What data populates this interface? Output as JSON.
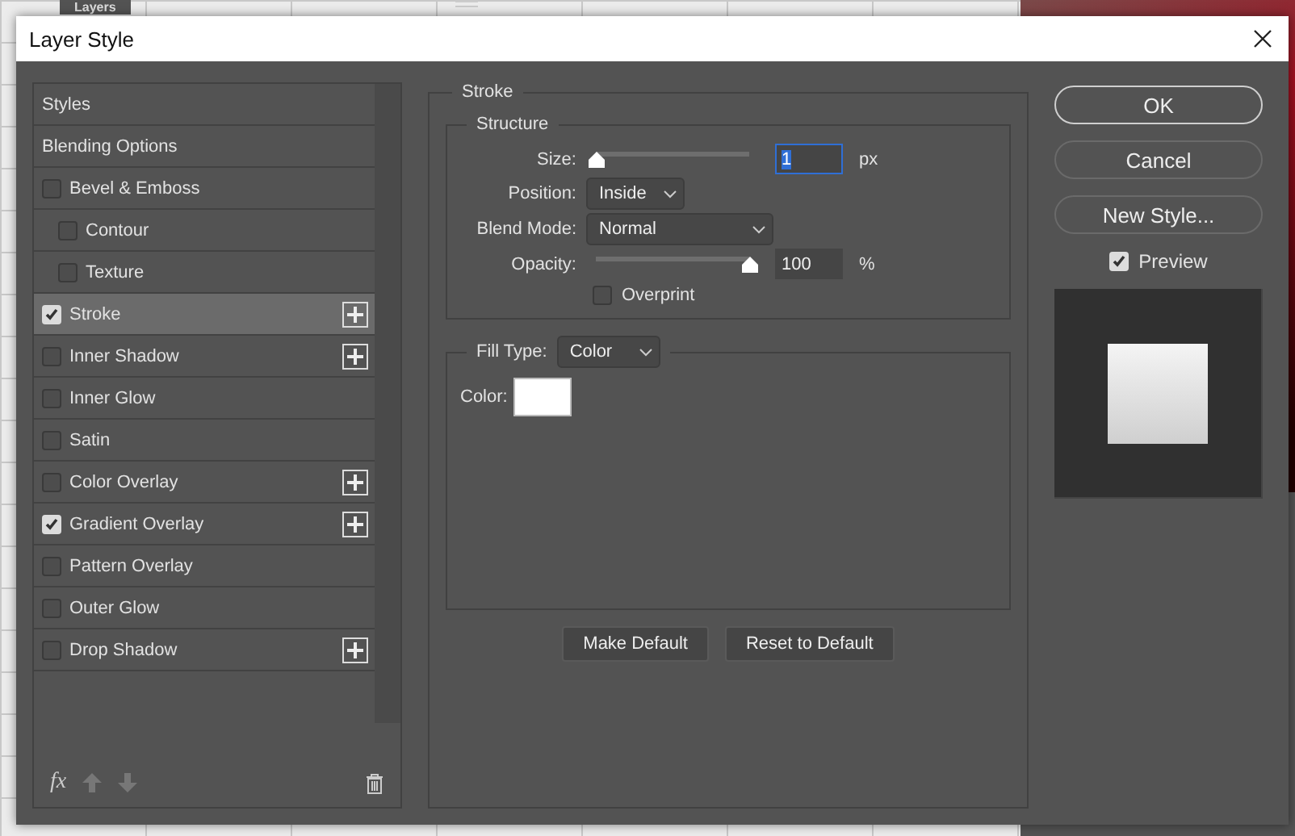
{
  "background": {
    "panel_tab": "Layers"
  },
  "window": {
    "title": "Layer Style"
  },
  "styles_list": {
    "items": [
      {
        "label": "Styles",
        "kind": "header",
        "selected": false
      },
      {
        "label": "Blending Options",
        "kind": "header",
        "selected": false
      },
      {
        "label": "Bevel & Emboss",
        "kind": "effect",
        "checked": false,
        "selected": false,
        "add_button": false,
        "children": [
          {
            "label": "Contour",
            "kind": "effect",
            "checked": false,
            "selected": false,
            "add_button": false
          },
          {
            "label": "Texture",
            "kind": "effect",
            "checked": false,
            "selected": false,
            "add_button": false
          }
        ]
      },
      {
        "label": "Stroke",
        "kind": "effect",
        "checked": true,
        "selected": true,
        "add_button": true
      },
      {
        "label": "Inner Shadow",
        "kind": "effect",
        "checked": false,
        "selected": false,
        "add_button": true
      },
      {
        "label": "Inner Glow",
        "kind": "effect",
        "checked": false,
        "selected": false,
        "add_button": false
      },
      {
        "label": "Satin",
        "kind": "effect",
        "checked": false,
        "selected": false,
        "add_button": false
      },
      {
        "label": "Color Overlay",
        "kind": "effect",
        "checked": false,
        "selected": false,
        "add_button": true
      },
      {
        "label": "Gradient Overlay",
        "kind": "effect",
        "checked": true,
        "selected": false,
        "add_button": true
      },
      {
        "label": "Pattern Overlay",
        "kind": "effect",
        "checked": false,
        "selected": false,
        "add_button": false
      },
      {
        "label": "Outer Glow",
        "kind": "effect",
        "checked": false,
        "selected": false,
        "add_button": false
      },
      {
        "label": "Drop Shadow",
        "kind": "effect",
        "checked": false,
        "selected": false,
        "add_button": true
      }
    ],
    "fx_label": "fx"
  },
  "stroke": {
    "title": "Stroke",
    "structure": {
      "title": "Structure",
      "size": {
        "label": "Size:",
        "level": 0,
        "value": "1",
        "unit": "px"
      },
      "position": {
        "label": "Position:",
        "value": "Inside"
      },
      "blend_mode": {
        "label": "Blend Mode:",
        "value": "Normal"
      },
      "opacity": {
        "label": "Opacity:",
        "level": 1,
        "value": "100",
        "unit": "%"
      },
      "overprint": {
        "label": "Overprint",
        "checked": false
      }
    },
    "fill": {
      "label": "Fill Type:",
      "value": "Color",
      "color_label": "Color:",
      "color": "#ffffff"
    },
    "buttons": [
      "Make Default",
      "Reset to Default"
    ]
  },
  "actions": [
    {
      "label": "OK",
      "default": true
    },
    {
      "label": "Cancel",
      "default": false
    },
    {
      "label": "New Style...",
      "default": false
    }
  ],
  "preview": {
    "label": "Preview",
    "checked": true
  }
}
